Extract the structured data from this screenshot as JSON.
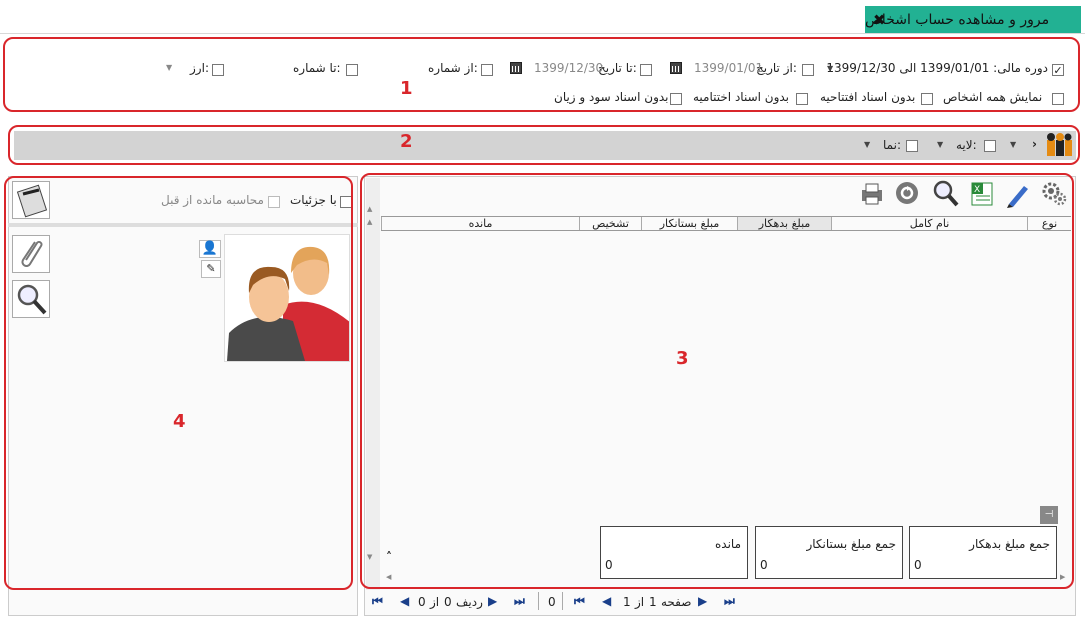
{
  "window": {
    "title": "مرور و مشاهده حساب اشخاص",
    "close": "✖"
  },
  "filters": {
    "fiscal_period_label": "دوره مالی:",
    "fiscal_period_value": "1399/01/01 الی 1399/12/30",
    "from_date_label": "از تاریخ:",
    "from_date_value": "1399/01/01",
    "to_date_label": "تا تاریخ:",
    "to_date_value": "1399/12/30",
    "from_number_label": "از شماره:",
    "to_number_label": "تا شماره:",
    "currency_label": "ارز:",
    "show_all_persons": "نمایش همه اشخاص",
    "no_opening_docs": "بدون اسناد افتتاحیه",
    "no_closing_docs": "بدون اسناد اختتامیه",
    "no_pl_docs": "بدون اسناد سود و زیان"
  },
  "toolbar2": {
    "layer_label": "لایه:",
    "view_label": "نما:"
  },
  "grid": {
    "columns": [
      "نوع",
      "نام کامل",
      "مبلغ بدهکار",
      "مبلغ بستانکار",
      "تشخیص",
      "مانده"
    ],
    "totals": [
      {
        "label": "جمع مبلغ بدهکار",
        "value": "0"
      },
      {
        "label": "جمع مبلغ بستانکار",
        "value": "0"
      },
      {
        "label": "مانده",
        "value": "0"
      }
    ],
    "pager": {
      "page_label": "صفحه",
      "page": "1",
      "of": "از",
      "total_pages": "1",
      "page_size": "0",
      "row_label": "ردیف",
      "row": "0",
      "row_of": "از",
      "row_total": "0"
    }
  },
  "left_panel": {
    "with_details": "با جزئیات",
    "calc_prev_balance": "محاسبه مانده از قبل"
  },
  "markers": [
    "1",
    "2",
    "3",
    "4"
  ]
}
